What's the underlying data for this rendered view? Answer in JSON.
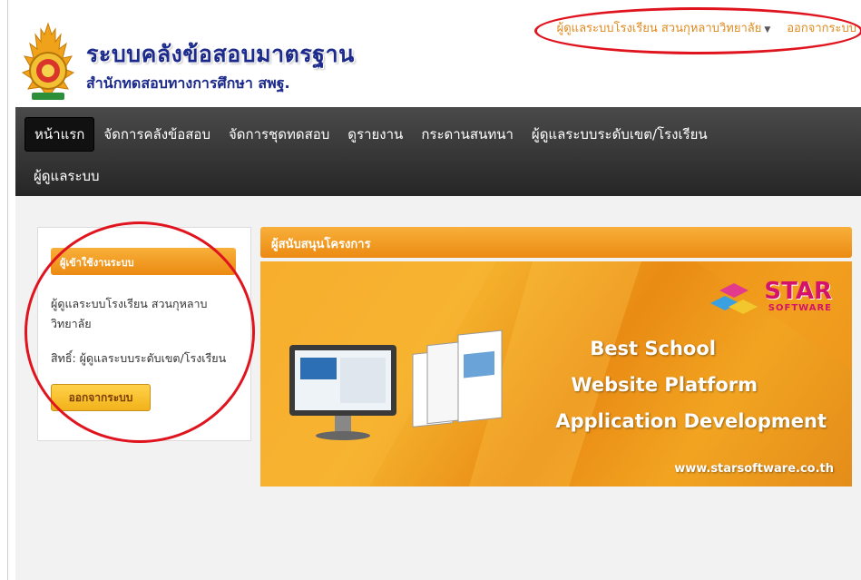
{
  "header": {
    "site_title": "ระบบคลังข้อสอบมาตรฐาน",
    "site_subtitle": "สำนักทดสอบทางการศึกษา สพฐ.",
    "user_name": "ผู้ดูแลระบบโรงเรียน สวนกุหลาบวิทยาลัย",
    "logout_label": "ออกจากระบบ"
  },
  "nav": {
    "row1": [
      "หน้าแรก",
      "จัดการคลังข้อสอบ",
      "จัดการชุดทดสอบ",
      "ดูรายงาน",
      "กระดานสนทนา",
      "ผู้ดูแลระบบระดับเขต/โรงเรียน"
    ],
    "row2": [
      "ผู้ดูแลระบบ"
    ],
    "active": "หน้าแรก"
  },
  "login_panel": {
    "title": "ผู้เข้าใช้งานระบบ",
    "user_line1": "ผู้ดูแลระบบโรงเรียน สวนกุหลาบ",
    "user_line2": "วิทยาลัย",
    "rights": "สิทธิ์: ผู้ดูแลระบบระดับเขต/โรงเรียน",
    "logout_button": "ออกจากระบบ"
  },
  "sponsor": {
    "title": "ผู้สนับสนุนโครงการ",
    "brand_big": "STAR",
    "brand_small": "SOFTWARE",
    "line1": "Best School",
    "line2": "Website Platform",
    "line3": "Application Development",
    "url": "www.starsoftware.co.th"
  },
  "colors": {
    "accent_orange": "#ec8a12",
    "title_blue": "#1c2a8c",
    "annotation_red": "#e0141e"
  }
}
